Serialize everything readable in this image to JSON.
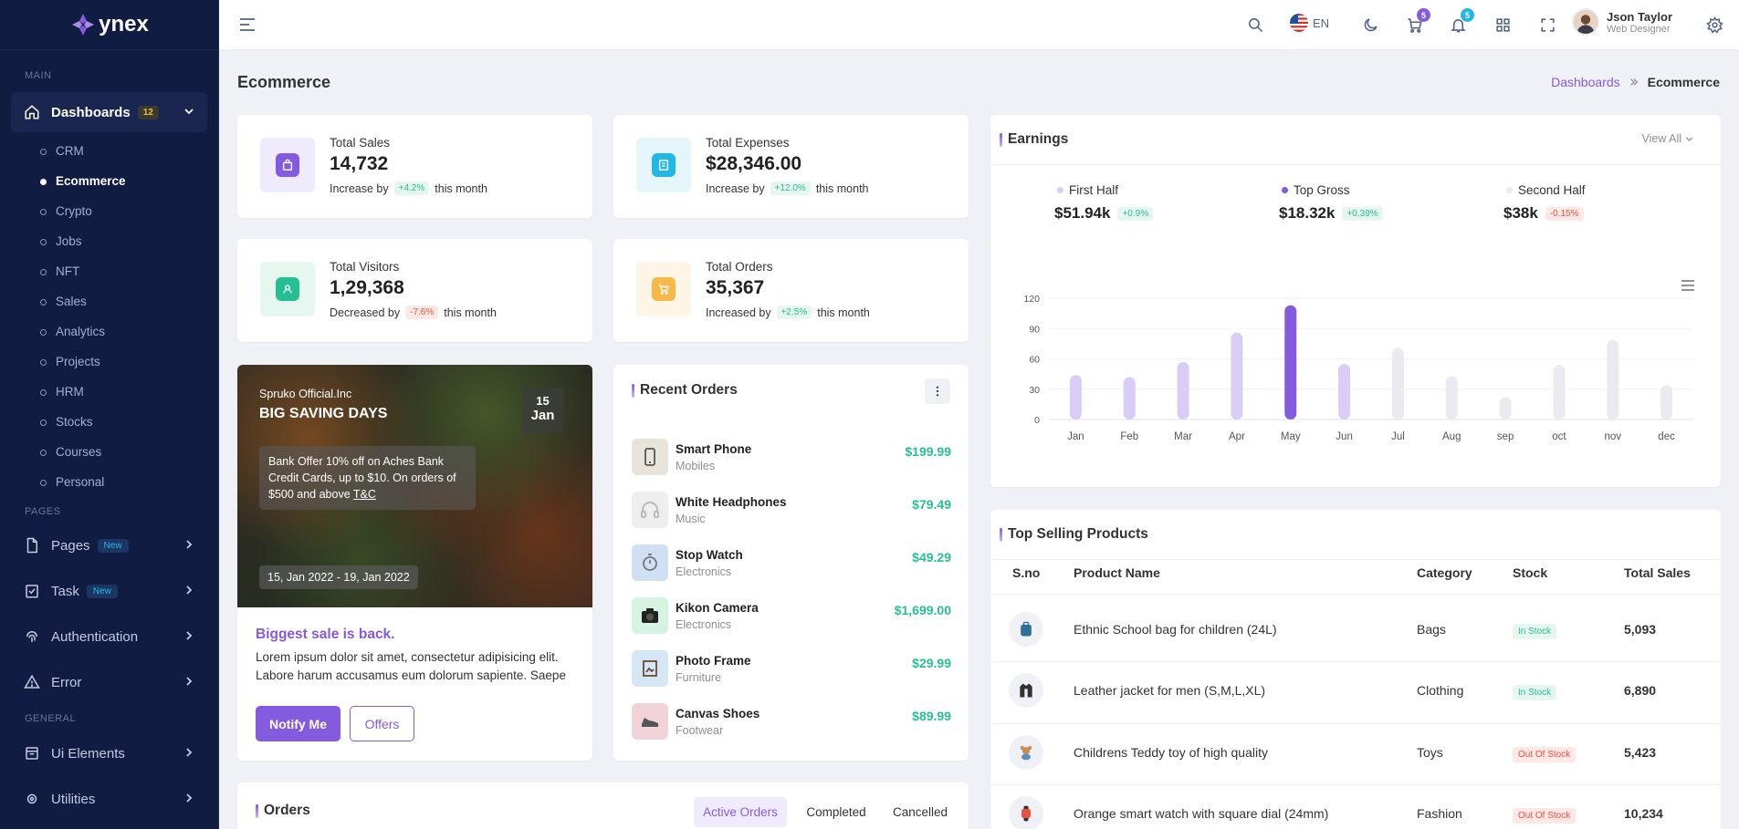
{
  "brand": {
    "name": "ynex"
  },
  "sidebar": {
    "main_label": "MAIN",
    "pages_label": "PAGES",
    "general_label": "GENERAL",
    "dashboards": {
      "label": "Dashboards",
      "badge": "12"
    },
    "sub_items": [
      "CRM",
      "Ecommerce",
      "Crypto",
      "Jobs",
      "NFT",
      "Sales",
      "Analytics",
      "Projects",
      "HRM",
      "Stocks",
      "Courses",
      "Personal"
    ],
    "pages": {
      "label": "Pages",
      "badge": "New"
    },
    "task": {
      "label": "Task",
      "badge": "New"
    },
    "authentication": {
      "label": "Authentication"
    },
    "error": {
      "label": "Error"
    },
    "ui_elements": {
      "label": "Ui Elements"
    },
    "utilities": {
      "label": "Utilities"
    }
  },
  "header": {
    "lang": "EN",
    "cart_count": "5",
    "notif_count": "5",
    "user_name": "Json Taylor",
    "user_role": "Web Designer"
  },
  "page": {
    "title": "Ecommerce",
    "breadcrumb_root": "Dashboards",
    "breadcrumb_current": "Ecommerce"
  },
  "stats": {
    "sales": {
      "label": "Total Sales",
      "value": "14,732",
      "trend_text": "Increase by",
      "pill": "+4.2%",
      "suffix": "this month"
    },
    "expenses": {
      "label": "Total Expenses",
      "value": "$28,346.00",
      "trend_text": "Increase by",
      "pill": "+12.0%",
      "suffix": "this month"
    },
    "visitors": {
      "label": "Total Visitors",
      "value": "1,29,368",
      "trend_text": "Decreased by",
      "pill": "-7.6%",
      "suffix": "this month"
    },
    "orders": {
      "label": "Total Orders",
      "value": "35,367",
      "trend_text": "Increased by",
      "pill": "+2.5%",
      "suffix": "this month"
    }
  },
  "banner": {
    "company": "Spruko Official.Inc",
    "headline": "BIG SAVING DAYS",
    "date_day": "15",
    "date_month": "Jan",
    "offer_text": "Bank Offer 10% off on Aches Bank Credit Cards, up to $10. On orders of $500 and above",
    "offer_link": "T&C",
    "period": "15, Jan 2022 - 19, Jan 2022",
    "sale_title": "Biggest sale is back.",
    "sale_text": "Lorem ipsum dolor sit amet, consectetur adipisicing elit. Labore harum accusamus eum dolorum sapiente. Saepe",
    "notify_btn": "Notify Me",
    "offers_btn": "Offers"
  },
  "recent_orders": {
    "title": "Recent Orders",
    "items": [
      {
        "name": "Smart Phone",
        "category": "Mobiles",
        "price": "$199.99"
      },
      {
        "name": "White Headphones",
        "category": "Music",
        "price": "$79.49"
      },
      {
        "name": "Stop Watch",
        "category": "Electronics",
        "price": "$49.29"
      },
      {
        "name": "Kikon Camera",
        "category": "Electronics",
        "price": "$1,699.00"
      },
      {
        "name": "Photo Frame",
        "category": "Furniture",
        "price": "$29.99"
      },
      {
        "name": "Canvas Shoes",
        "category": "Footwear",
        "price": "$89.99"
      }
    ]
  },
  "orders_card": {
    "title": "Orders",
    "tabs": [
      "Active Orders",
      "Completed",
      "Cancelled"
    ]
  },
  "earnings": {
    "title": "Earnings",
    "view_all": "View All",
    "summary": [
      {
        "label": "First Half",
        "value": "$51.94k",
        "change": "+0.9%",
        "dot_color": "#d9cdf7",
        "trend": "up"
      },
      {
        "label": "Top Gross",
        "value": "$18.32k",
        "change": "+0.39%",
        "dot_color": "#845adf",
        "trend": "up"
      },
      {
        "label": "Second Half",
        "value": "$38k",
        "change": "-0.15%",
        "dot_color": "#e9ebf0",
        "trend": "down"
      }
    ]
  },
  "chart_data": {
    "type": "bar",
    "categories": [
      "Jan",
      "Feb",
      "Mar",
      "Apr",
      "May",
      "Jun",
      "Jul",
      "Aug",
      "sep",
      "oct",
      "nov",
      "dec"
    ],
    "values": [
      44,
      42,
      57,
      86,
      113,
      55,
      71,
      43,
      22,
      54,
      79,
      34
    ],
    "bar_colors": [
      "#d9cdf7",
      "#d9cdf7",
      "#d9cdf7",
      "#d9cdf7",
      "#845adf",
      "#d9cdf7",
      "#e9ebf0",
      "#e9ebf0",
      "#e9ebf0",
      "#e9ebf0",
      "#e9ebf0",
      "#e9ebf0"
    ],
    "yticks": [
      "120",
      "90",
      "60",
      "30",
      "0"
    ],
    "ylim": [
      0,
      120
    ],
    "grid": true
  },
  "top_products": {
    "title": "Top Selling Products",
    "columns": [
      "S.no",
      "Product Name",
      "Category",
      "Stock",
      "Total Sales"
    ],
    "rows": [
      {
        "name": "Ethnic School bag for children (24L)",
        "category": "Bags",
        "stock": "In Stock",
        "stock_status": "in",
        "sales": "5,093",
        "icon": "bag-icon"
      },
      {
        "name": "Leather jacket for men (S,M,L,XL)",
        "category": "Clothing",
        "stock": "In Stock",
        "stock_status": "in",
        "sales": "6,890",
        "icon": "jacket-icon"
      },
      {
        "name": "Childrens Teddy toy of high quality",
        "category": "Toys",
        "stock": "Out Of Stock",
        "stock_status": "out",
        "sales": "5,423",
        "icon": "teddy-icon"
      },
      {
        "name": "Orange smart watch with square dial (24mm)",
        "category": "Fashion",
        "stock": "Out Of Stock",
        "stock_status": "out",
        "sales": "10,234",
        "icon": "watch-icon"
      }
    ]
  }
}
